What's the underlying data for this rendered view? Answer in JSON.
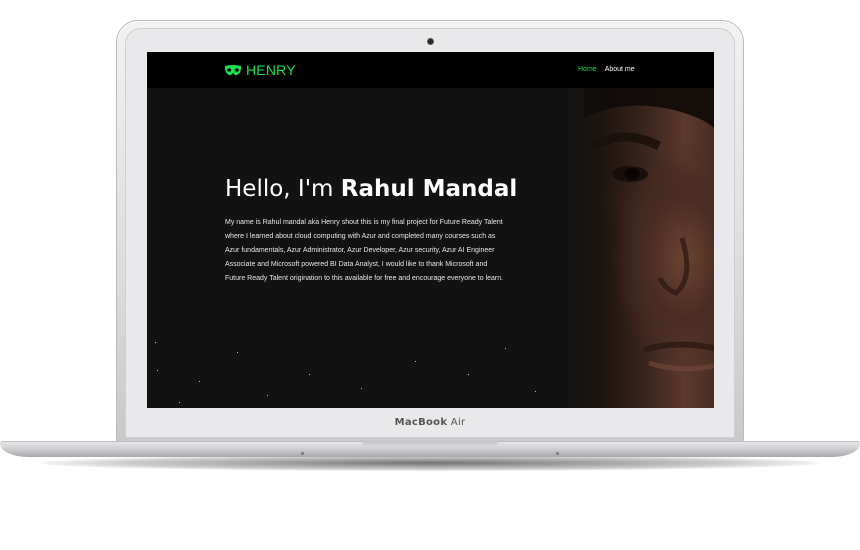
{
  "device": {
    "model_brand": "MacBook",
    "model_name": "Air"
  },
  "site": {
    "brand": "HENRY",
    "brand_icon": "mask-icon",
    "accent_color": "#19e24f",
    "nav": [
      {
        "label": "Home",
        "active": true
      },
      {
        "label": "About me",
        "active": false
      }
    ]
  },
  "hero": {
    "greeting": "Hello, I'm",
    "name": "Rahul Mandal",
    "bio": "My name is Rahul mandal aka Henry shout this is my final project for Future Ready Talent where I learned about cloud computing with Azur and completed many courses such as Azur fundamentals, Azur Administrator, Azur Developer, Azur security, Azur AI Engineer Associate and Microsoft powered BI Data Analyst, I would like to thank Microsoft and Future Ready Talent origination to this available for free and encourage everyone to learn."
  }
}
